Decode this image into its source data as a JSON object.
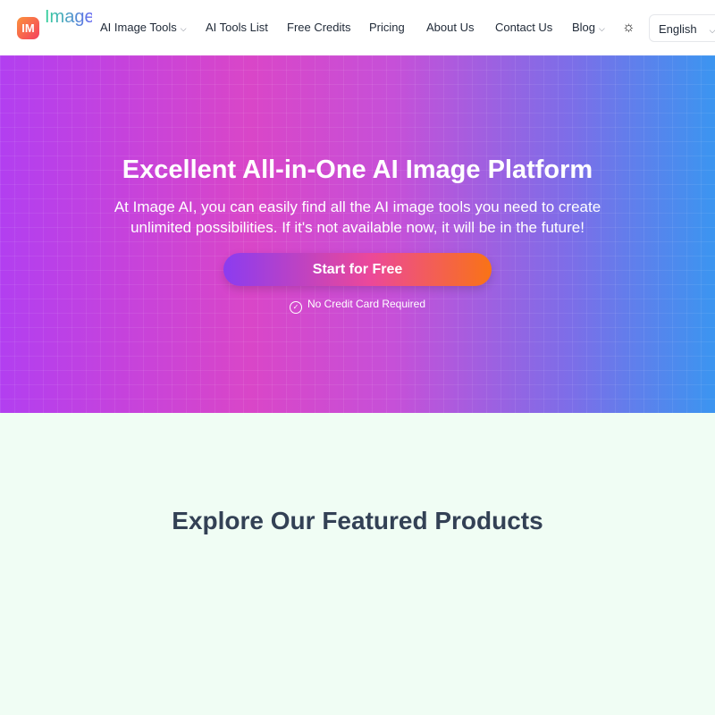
{
  "nav": {
    "logo_text": "IM",
    "brand": "Image AI",
    "items": [
      {
        "label": "AI Image Tools",
        "dropdown": true
      },
      {
        "label": "AI Tools List"
      },
      {
        "label": "Free Credits"
      },
      {
        "label": "Pricing"
      },
      {
        "label": "About Us"
      },
      {
        "label": "Contact Us"
      },
      {
        "label": "Blog",
        "dropdown": true
      }
    ],
    "theme_icon": "sun-icon",
    "language": "English"
  },
  "hero": {
    "title": "Excellent All-in-One AI Image Platform",
    "subtitle": "At Image AI, you can easily find all the AI image tools you need to create unlimited possibilities. If it's not available now, it will be in the future!",
    "cta": "Start for Free",
    "note": "No Credit Card Required"
  },
  "featured": {
    "title": "Explore Our Featured Products"
  },
  "colors": {
    "hero_start": "#b23ff0",
    "hero_end": "#3b95f0",
    "section_bg": "#f0fdf4"
  }
}
